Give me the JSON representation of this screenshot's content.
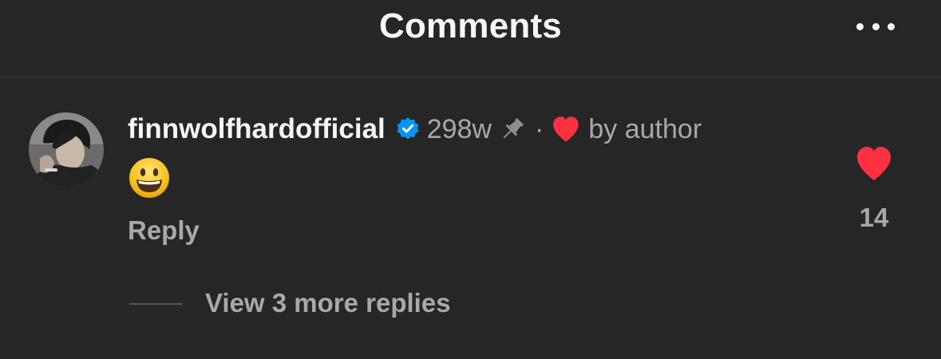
{
  "header": {
    "title": "Comments",
    "more_icon": "more-horizontal-icon"
  },
  "comment": {
    "username": "finnwolfhardofficial",
    "verified_icon": "verified-badge-icon",
    "time": "298w",
    "pin_icon": "pin-icon",
    "separator": "·",
    "author_like_icon": "heart-icon",
    "author_like_text": "by author",
    "text": "😀",
    "reply_label": "Reply",
    "like_icon": "heart-icon",
    "like_count": "14"
  },
  "replies": {
    "view_more_label": "View 3 more replies"
  },
  "colors": {
    "background": "#262626",
    "primary_text": "#f5f5f5",
    "secondary_text": "#a8a8a8",
    "heart_red": "#ff3040",
    "verified_blue": "#0095f6",
    "divider": "#383838"
  }
}
